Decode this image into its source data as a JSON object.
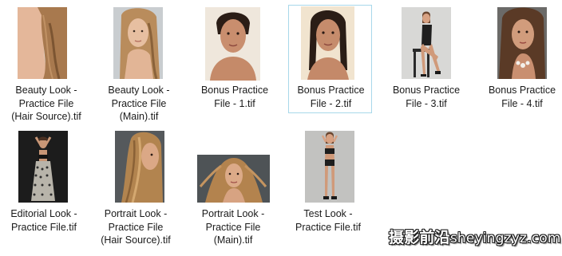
{
  "files": [
    {
      "lines": [
        "Beauty Look -",
        "Practice File",
        "(Hair Source).tif"
      ],
      "selected": false
    },
    {
      "lines": [
        "Beauty Look -",
        "Practice File",
        "(Main).tif"
      ],
      "selected": false
    },
    {
      "lines": [
        "Bonus Practice",
        "File - 1.tif"
      ],
      "selected": false
    },
    {
      "lines": [
        "Bonus Practice",
        "File - 2.tif"
      ],
      "selected": true
    },
    {
      "lines": [
        "Bonus Practice",
        "File - 3.tif"
      ],
      "selected": false
    },
    {
      "lines": [
        "Bonus Practice",
        "File - 4.tif"
      ],
      "selected": false
    },
    {
      "lines": [
        "Editorial Look -",
        "Practice File.tif"
      ],
      "selected": false
    },
    {
      "lines": [
        "Portrait Look -",
        "Practice File",
        "(Hair Source).tif"
      ],
      "selected": false
    },
    {
      "lines": [
        "Portrait Look -",
        "Practice File",
        "(Main).tif"
      ],
      "selected": false
    },
    {
      "lines": [
        "Test Look -",
        "Practice File.tif"
      ],
      "selected": false
    }
  ],
  "watermark": {
    "cjk": "摄影前沿",
    "latin": "sheyingzyz.com"
  }
}
